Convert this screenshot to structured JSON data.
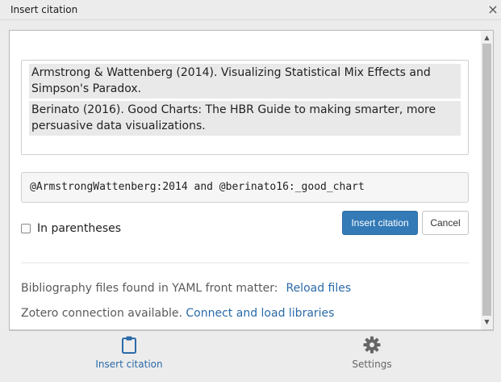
{
  "window": {
    "title": "Insert citation",
    "close_glyph": "×"
  },
  "results": [
    "Armstrong & Wattenberg (2014). Visualizing Statistical Mix Effects and Simpson's Paradox.",
    "Berinato (2016). Good Charts: The HBR Guide to making smarter, more persuasive data visualizations."
  ],
  "citation_keys": "@ArmstrongWattenberg:2014 and @berinato16:_good_chart",
  "in_parentheses": {
    "label": "In parentheses",
    "checked": false
  },
  "buttons": {
    "insert": "Insert citation",
    "cancel": "Cancel"
  },
  "bibliography": {
    "text": "Bibliography files found in YAML front matter:",
    "link": "Reload files"
  },
  "zotero": {
    "text": "Zotero connection available.",
    "link": "Connect and load libraries"
  },
  "tabs": [
    {
      "label": "Insert citation",
      "icon": "clipboard-icon",
      "active": true,
      "color": "#2a6aa8"
    },
    {
      "label": "Settings",
      "icon": "gear-icon",
      "active": false,
      "color": "#666666"
    }
  ],
  "colors": {
    "primary": "#337ab7",
    "link": "#2a6aa8",
    "background": "#ececec"
  }
}
